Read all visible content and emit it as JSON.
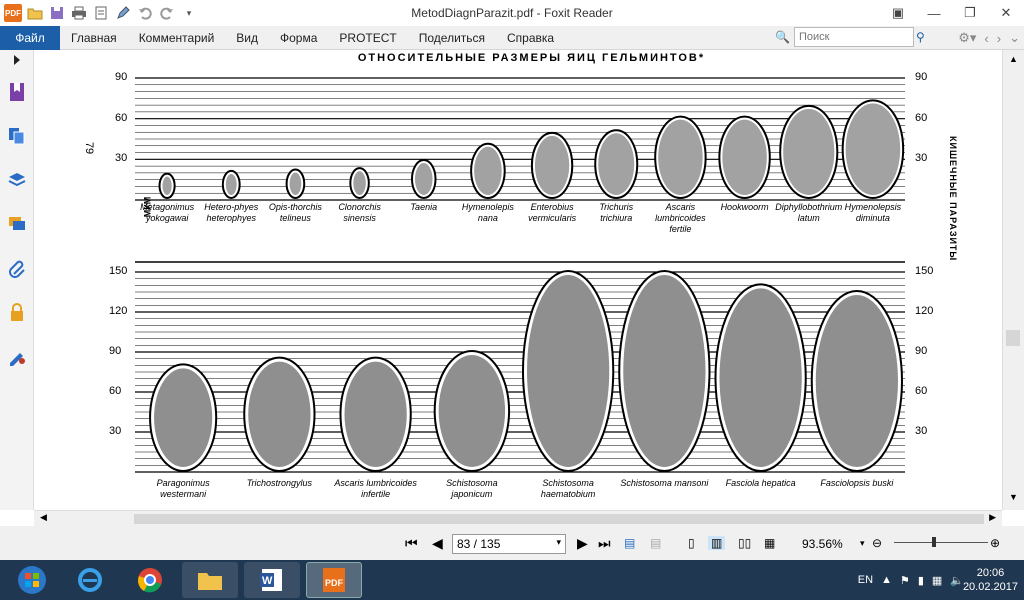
{
  "window": {
    "title": "MetodDiagnParazit.pdf - Foxit Reader",
    "app_logo_text": "PDF"
  },
  "ribbon": {
    "file_tab": "Файл",
    "tabs": [
      "Главная",
      "Комментарий",
      "Вид",
      "Форма",
      "PROTECT",
      "Поделиться",
      "Справка"
    ]
  },
  "search": {
    "placeholder": "Поиск"
  },
  "document": {
    "heading": "ОТНОСИТЕЛЬНЫЕ РАЗМЕРЫ ЯИЦ ГЕЛЬМИНТОВ*",
    "page_number": "79",
    "side_caption": "КИШЕЧНЫЕ ПАРАЗИТЫ",
    "unit_label": "МКМ",
    "top_scale": [
      "90",
      "60",
      "30"
    ],
    "bottom_scale": [
      "150",
      "120",
      "90",
      "60",
      "30"
    ],
    "top_eggs": [
      {
        "name": "Metagonimus yokogawai",
        "size": 18
      },
      {
        "name": "Hetero-phyes heterophyes",
        "size": 20
      },
      {
        "name": "Opis-thorchis telineus",
        "size": 21
      },
      {
        "name": "Clonorchis sinensis",
        "size": 22
      },
      {
        "name": "Taenia",
        "size": 28
      },
      {
        "name": "Hymenolepis nana",
        "size": 40
      },
      {
        "name": "Enterobius vermicularis",
        "size": 48
      },
      {
        "name": "Trichuris trichiura",
        "size": 50
      },
      {
        "name": "Ascaris lumbricoides fertile",
        "size": 60
      },
      {
        "name": "Hookwoorm",
        "size": 60
      },
      {
        "name": "Diphyllobothrium latum",
        "size": 68
      },
      {
        "name": "Hymenolepsis diminuta",
        "size": 72
      }
    ],
    "bottom_eggs": [
      {
        "name": "Paragonimus westermani",
        "size": 80
      },
      {
        "name": "Trichostrongylus",
        "size": 85
      },
      {
        "name": "Ascaris lumbricoides infertile",
        "size": 85
      },
      {
        "name": "Schistosoma japonicum",
        "size": 90
      },
      {
        "name": "Schistosoma haematobium",
        "size": 150
      },
      {
        "name": "Schistosoma mansoni",
        "size": 150
      },
      {
        "name": "Fasciola hepatica",
        "size": 140
      },
      {
        "name": "Fasciolopsis buski",
        "size": 135
      }
    ]
  },
  "statusbar": {
    "page_indicator": "83 / 135",
    "zoom": "93.56%"
  },
  "tray": {
    "language": "EN",
    "time": "20:06",
    "date": "20.02.2017"
  },
  "colors": {
    "file_tab": "#1c5fa8",
    "taskbar": "#1f3750",
    "foxit_orange": "#e8701a"
  }
}
